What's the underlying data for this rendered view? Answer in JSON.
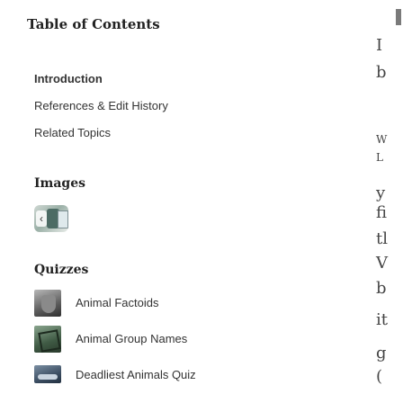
{
  "toc": {
    "title": "Table of Contents",
    "items": [
      "Introduction",
      "References & Edit History",
      "Related Topics"
    ]
  },
  "images": {
    "title": "Images"
  },
  "quizzes": {
    "title": "Quizzes",
    "items": [
      "Animal Factoids",
      "Animal Group Names",
      "Deadliest Animals Quiz"
    ]
  },
  "edge_text": [
    "I",
    "b",
    "W",
    "L",
    "y",
    "fi",
    "tl",
    "V",
    "b",
    "it",
    "g",
    "("
  ]
}
